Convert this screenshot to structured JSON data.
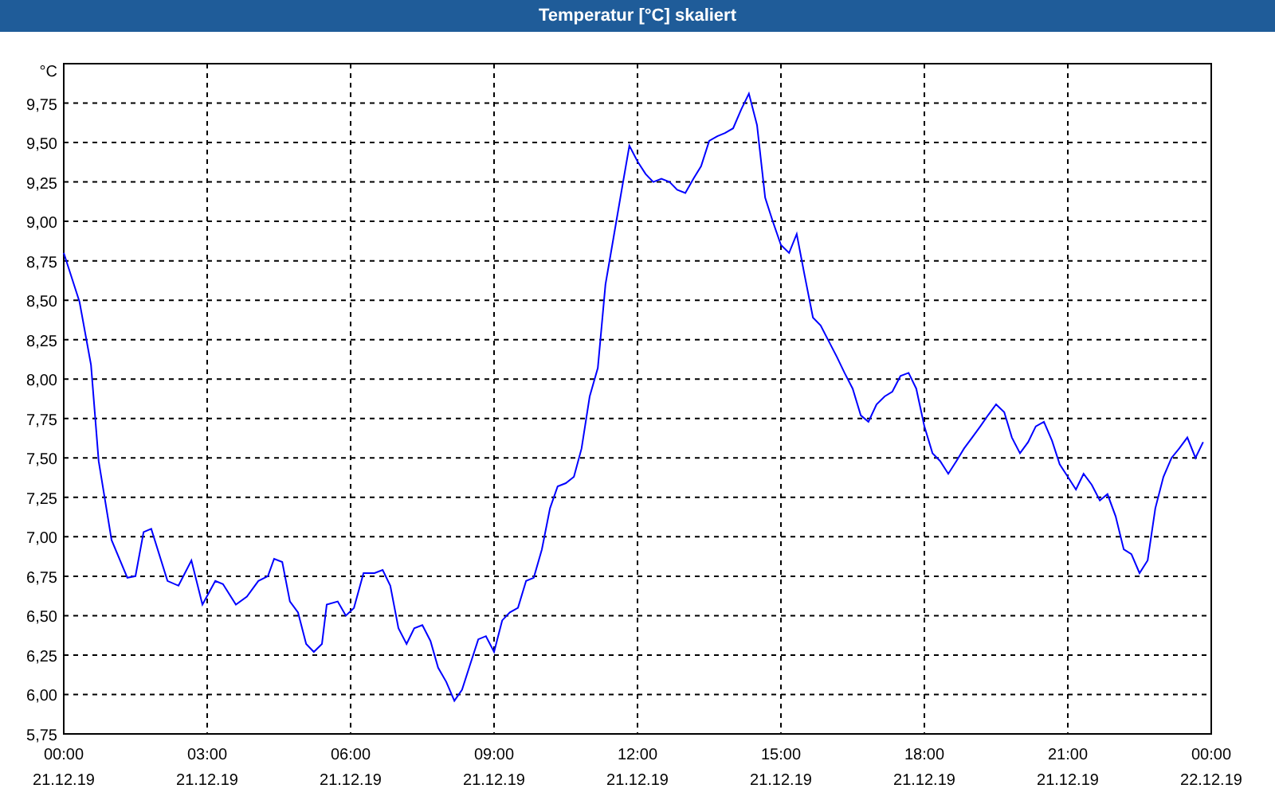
{
  "window": {
    "title": "Temperatur [°C] skaliert"
  },
  "chart": {
    "x_dates": [
      "21.12.19",
      "21.12.19",
      "21.12.19",
      "21.12.19",
      "21.12.19",
      "21.12.19",
      "21.12.19",
      "21.12.19",
      "22.12.19"
    ],
    "chart_data": {
      "type": "line",
      "grid": true,
      "ylabel": "°C",
      "xlim": [
        0,
        24
      ],
      "ylim": [
        5.75,
        10
      ],
      "xticks": [
        {
          "value": 0,
          "label": "00:00"
        },
        {
          "value": 3,
          "label": "03:00"
        },
        {
          "value": 6,
          "label": "06:00"
        },
        {
          "value": 9,
          "label": "09:00"
        },
        {
          "value": 12,
          "label": "12:00"
        },
        {
          "value": 15,
          "label": "15:00"
        },
        {
          "value": 18,
          "label": "18:00"
        },
        {
          "value": 21,
          "label": "21:00"
        },
        {
          "value": 24,
          "label": "00:00"
        }
      ],
      "yticks": [
        {
          "value": 5.75,
          "label": "5,75"
        },
        {
          "value": 6,
          "label": "6,00"
        },
        {
          "value": 6.25,
          "label": "6,25"
        },
        {
          "value": 6.5,
          "label": "6,50"
        },
        {
          "value": 6.75,
          "label": "6,75"
        },
        {
          "value": 7,
          "label": "7,00"
        },
        {
          "value": 7.25,
          "label": "7,25"
        },
        {
          "value": 7.5,
          "label": "7,50"
        },
        {
          "value": 7.75,
          "label": "7,75"
        },
        {
          "value": 8,
          "label": "8,00"
        },
        {
          "value": 8.25,
          "label": "8,25"
        },
        {
          "value": 8.5,
          "label": "8,50"
        },
        {
          "value": 8.75,
          "label": "8,75"
        },
        {
          "value": 9,
          "label": "9,00"
        },
        {
          "value": 9.25,
          "label": "9,25"
        },
        {
          "value": 9.5,
          "label": "9,50"
        },
        {
          "value": 9.75,
          "label": "9,75"
        }
      ],
      "x": [
        0,
        0.33,
        0.57,
        0.73,
        1,
        1.33,
        1.5,
        1.67,
        1.83,
        2.17,
        2.4,
        2.67,
        2.9,
        3.17,
        3.33,
        3.6,
        3.83,
        4.07,
        4.27,
        4.4,
        4.57,
        4.73,
        4.9,
        5.07,
        5.23,
        5.4,
        5.5,
        5.73,
        5.9,
        6.07,
        6.27,
        6.5,
        6.67,
        6.83,
        7,
        7.17,
        7.33,
        7.5,
        7.67,
        7.83,
        8,
        8.17,
        8.33,
        8.5,
        8.67,
        8.83,
        9,
        9.17,
        9.33,
        9.5,
        9.67,
        9.83,
        10,
        10.17,
        10.33,
        10.5,
        10.67,
        10.83,
        11,
        11.17,
        11.33,
        11.5,
        11.67,
        11.83,
        12,
        12.17,
        12.33,
        12.5,
        12.67,
        12.83,
        13,
        13.17,
        13.33,
        13.5,
        13.67,
        13.83,
        14,
        14.17,
        14.33,
        14.5,
        14.67,
        14.83,
        15,
        15.17,
        15.33,
        15.5,
        15.67,
        15.83,
        16,
        16.17,
        16.33,
        16.5,
        16.67,
        16.83,
        17,
        17.17,
        17.33,
        17.5,
        17.67,
        17.83,
        18,
        18.17,
        18.33,
        18.5,
        18.67,
        18.83,
        19,
        19.17,
        19.33,
        19.5,
        19.67,
        19.83,
        20,
        20.17,
        20.33,
        20.5,
        20.67,
        20.83,
        21,
        21.17,
        21.33,
        21.5,
        21.67,
        21.83,
        22,
        22.17,
        22.33,
        22.5,
        22.67,
        22.83,
        23,
        23.17,
        23.33,
        23.5,
        23.67,
        23.83
      ],
      "series": [
        {
          "color": "#0000ff",
          "values": [
            8.8,
            8.49,
            8.09,
            7.48,
            6.98,
            6.74,
            6.75,
            7.03,
            7.05,
            6.72,
            6.69,
            6.85,
            6.57,
            6.72,
            6.7,
            6.57,
            6.62,
            6.72,
            6.75,
            6.86,
            6.84,
            6.59,
            6.52,
            6.32,
            6.27,
            6.32,
            6.57,
            6.59,
            6.5,
            6.55,
            6.77,
            6.77,
            6.79,
            6.69,
            6.42,
            6.32,
            6.42,
            6.44,
            6.34,
            6.17,
            6.08,
            5.96,
            6.03,
            6.19,
            6.35,
            6.37,
            6.27,
            6.47,
            6.52,
            6.55,
            6.72,
            6.74,
            6.92,
            7.18,
            7.32,
            7.34,
            7.38,
            7.56,
            7.89,
            8.07,
            8.6,
            8.9,
            9.2,
            9.48,
            9.38,
            9.3,
            9.25,
            9.27,
            9.25,
            9.2,
            9.18,
            9.27,
            9.35,
            9.51,
            9.54,
            9.56,
            9.59,
            9.71,
            9.81,
            9.61,
            9.15,
            9,
            8.85,
            8.8,
            8.92,
            8.65,
            8.39,
            8.34,
            8.24,
            8.14,
            8.04,
            7.94,
            7.77,
            7.73,
            7.84,
            7.89,
            7.92,
            8.02,
            8.04,
            7.94,
            7.7,
            7.53,
            7.48,
            7.4,
            7.48,
            7.56,
            7.63,
            7.7,
            7.77,
            7.84,
            7.79,
            7.63,
            7.53,
            7.6,
            7.7,
            7.73,
            7.61,
            7.46,
            7.38,
            7.3,
            7.4,
            7.33,
            7.23,
            7.27,
            7.13,
            6.92,
            6.89,
            6.77,
            6.85,
            7.18,
            7.38,
            7.5,
            7.56,
            7.63,
            7.5,
            7.6
          ]
        }
      ]
    }
  }
}
